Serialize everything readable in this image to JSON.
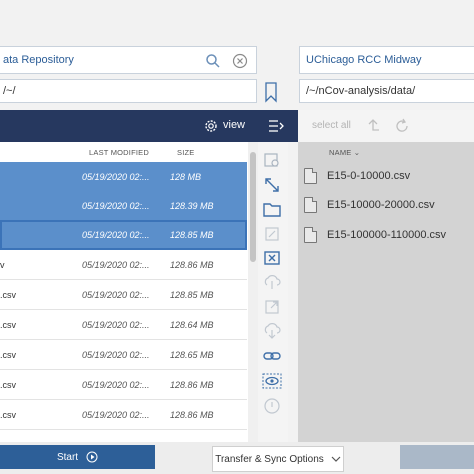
{
  "source": {
    "collection_name": "ata Repository",
    "path": "/~/",
    "view_label": "view"
  },
  "destination": {
    "collection_name": "UChicago RCC Midway",
    "path": "/~/nCov-analysis/data/",
    "select_all_label": "select all"
  },
  "left_table": {
    "headers": {
      "modified": "LAST MODIFIED",
      "size": "SIZE"
    },
    "rows": [
      {
        "name": "",
        "modified": "05/19/2020 02:...",
        "size": "128 MB",
        "selected": true
      },
      {
        "name": "",
        "modified": "05/19/2020 02:...",
        "size": "128.39 MB",
        "selected": true
      },
      {
        "name": "",
        "modified": "05/19/2020 02:...",
        "size": "128.85 MB",
        "selected": true
      },
      {
        "name": "v",
        "modified": "05/19/2020 02:...",
        "size": "128.86 MB",
        "selected": false
      },
      {
        "name": ".csv",
        "modified": "05/19/2020 02:...",
        "size": "128.85 MB",
        "selected": false
      },
      {
        "name": ".csv",
        "modified": "05/19/2020 02:...",
        "size": "128.64 MB",
        "selected": false
      },
      {
        "name": ".csv",
        "modified": "05/19/2020 02:...",
        "size": "128.65 MB",
        "selected": false
      },
      {
        "name": ".csv",
        "modified": "05/19/2020 02:...",
        "size": "128.86 MB",
        "selected": false
      },
      {
        "name": ".csv",
        "modified": "05/19/2020 02:...",
        "size": "128.86 MB",
        "selected": false
      }
    ]
  },
  "right_table": {
    "header": "NAME",
    "files": [
      "E15-0-10000.csv",
      "E15-10000-20000.csv",
      "E15-100000-110000.csv"
    ]
  },
  "bottom": {
    "start_label": "Start",
    "sync_label": "Transfer & Sync Options"
  },
  "colors": {
    "header_dark": "#26385f",
    "selected_row": "#5b8fcb",
    "accent_blue": "#2d5f98",
    "right_panel": "#d3d3d3"
  }
}
